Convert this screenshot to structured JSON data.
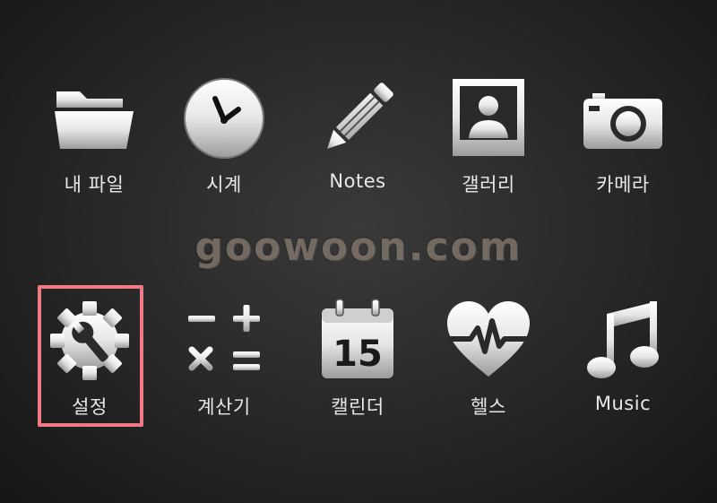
{
  "watermark": "goowoon.com",
  "accent_highlight_color": "#f07a86",
  "apps": [
    {
      "label": "내 파일",
      "icon": "folder-icon"
    },
    {
      "label": "시계",
      "icon": "clock-icon"
    },
    {
      "label": "Notes",
      "icon": "pencil-icon"
    },
    {
      "label": "갤러리",
      "icon": "gallery-icon"
    },
    {
      "label": "카메라",
      "icon": "camera-icon"
    },
    {
      "label": "설정",
      "icon": "settings-icon",
      "highlighted": true
    },
    {
      "label": "계산기",
      "icon": "calculator-icon"
    },
    {
      "label": "캘린더",
      "icon": "calendar-icon",
      "badge": "15"
    },
    {
      "label": "헬스",
      "icon": "heart-pulse-icon"
    },
    {
      "label": "Music",
      "icon": "music-note-icon"
    }
  ]
}
